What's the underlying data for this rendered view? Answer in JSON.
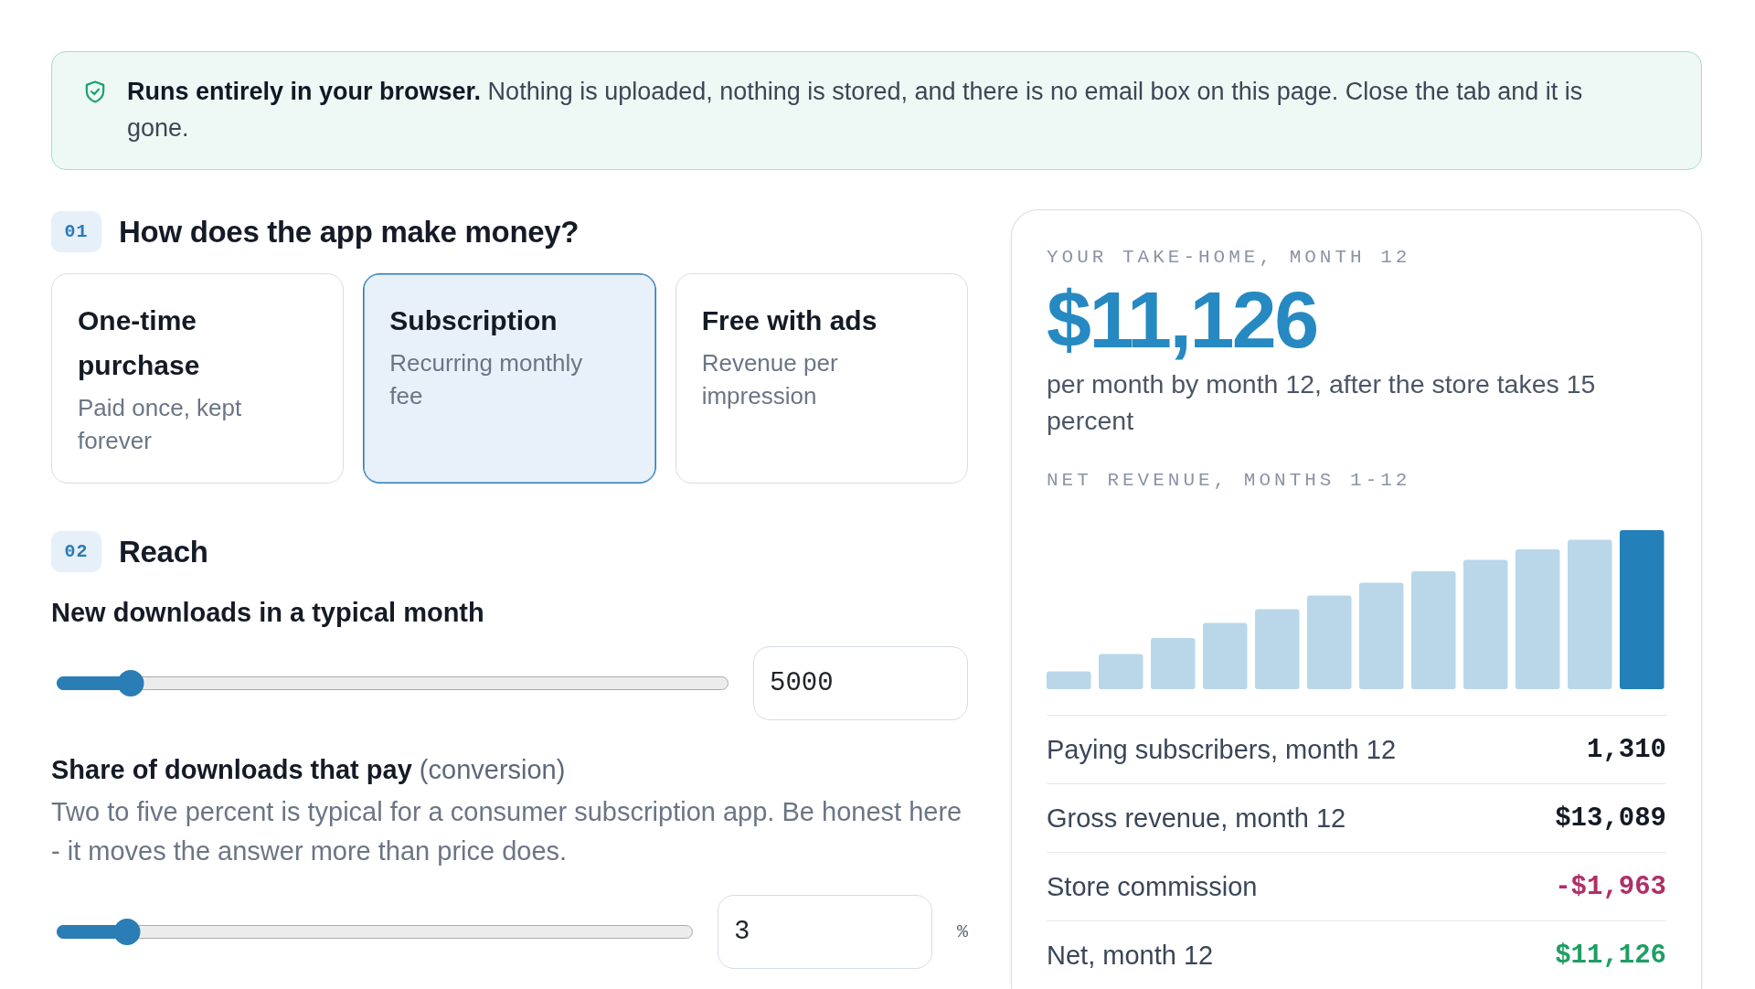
{
  "notice": {
    "text": "**Runs entirely in your browser.** Nothing is uploaded, nothing is stored, and there is no email box on this page. Close the tab and it is gone."
  },
  "model_section": {
    "number": "01",
    "title": "How does the app make money?",
    "options": [
      {
        "title": "One-time purchase",
        "description": "Paid once, kept forever",
        "selected": false
      },
      {
        "title": "Subscription",
        "description": "Recurring monthly fee",
        "selected": true
      },
      {
        "title": "Free with ads",
        "description": "Revenue per impression",
        "selected": false
      }
    ]
  },
  "reach_section": {
    "number": "02",
    "title": "Reach",
    "fields": [
      {
        "label": "New downloads in a typical month",
        "level": 0.11,
        "value": "5000"
      },
      {
        "label": "Share of downloads that pay",
        "note": "(conversion)",
        "help": "Two to five percent is typical for a consumer subscription app. Be honest here - it moves the answer more than price does.",
        "level": 0.11,
        "value": "3",
        "unit": "%"
      }
    ]
  },
  "summary": {
    "eyebrow": "YOUR TAKE-HOME, MONTH 12",
    "amount": "$11,126",
    "caption": "per month by month 12, after the store takes 15 percent",
    "chart_title": "NET REVENUE, MONTHS 1-12",
    "rows": [
      {
        "label": "Paying subscribers, month 12",
        "value": "1,310",
        "kind": "plain"
      },
      {
        "label": "Gross revenue, month 12",
        "value": "$13,089",
        "kind": "plain"
      },
      {
        "label": "Store commission",
        "value": "-$1,963",
        "kind": "deduction"
      },
      {
        "label": "Net, month 12",
        "value": "$11,126",
        "kind": "total"
      }
    ]
  }
}
